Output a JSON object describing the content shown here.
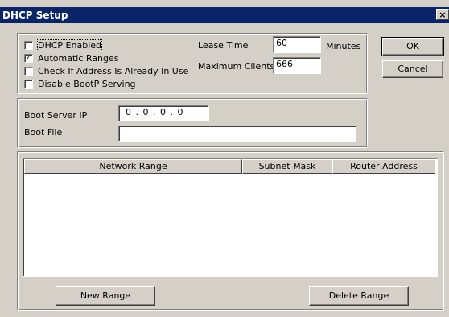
{
  "window": {
    "title": "DHCP Setup",
    "close_glyph": "×"
  },
  "options": {
    "dhcp_enabled": {
      "label": "DHCP Enabled",
      "checked": false
    },
    "automatic_ranges": {
      "label": "Automatic Ranges",
      "checked": true
    },
    "check_address": {
      "label": "Check If Address Is Already In Use",
      "checked": false
    },
    "disable_bootp": {
      "label": "Disable BootP Serving",
      "checked": false
    }
  },
  "lease": {
    "label": "Lease Time",
    "value": "60",
    "unit": "Minutes"
  },
  "max_clients": {
    "label": "Maximum Clients",
    "value": "666"
  },
  "buttons": {
    "ok": "OK",
    "cancel": "Cancel",
    "new_range": "New Range",
    "delete_range": "Delete Range"
  },
  "boot": {
    "server_ip_label": "Boot Server IP",
    "server_ip": "0 . 0 . 0 . 0",
    "file_label": "Boot File",
    "file_value": ""
  },
  "ranges_table": {
    "columns": [
      "Network Range",
      "Subnet Mask",
      "Router Address"
    ],
    "rows": []
  },
  "colors": {
    "title_bar": "#0a246a",
    "face": "#d4d0c8"
  },
  "icons": {
    "close": "close-icon",
    "check": "checkmark-icon"
  }
}
